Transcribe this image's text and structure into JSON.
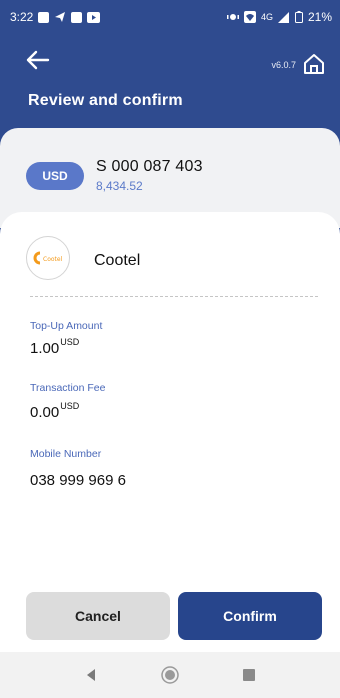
{
  "status_bar": {
    "time": "3:22",
    "network": "4G",
    "battery": "21%"
  },
  "header": {
    "version": "v6.0.7",
    "title": "Review and confirm"
  },
  "account": {
    "currency": "USD",
    "number": "S 000 087 403",
    "balance": "8,434.52"
  },
  "provider": {
    "logo_text": "Cootel",
    "name": "Cootel"
  },
  "details": {
    "topup_label": "Top-Up Amount",
    "topup_value": "1.00",
    "topup_unit": "USD",
    "fee_label": "Transaction Fee",
    "fee_value": "0.00",
    "fee_unit": "USD",
    "mobile_label": "Mobile Number",
    "mobile_value": "038 999 969 6"
  },
  "buttons": {
    "cancel": "Cancel",
    "confirm": "Confirm"
  },
  "colors": {
    "primary": "#2f4b8f",
    "accent": "#5a78c9",
    "label": "#4a68b8",
    "confirm": "#27458c",
    "cancel": "#dcdcdc"
  }
}
